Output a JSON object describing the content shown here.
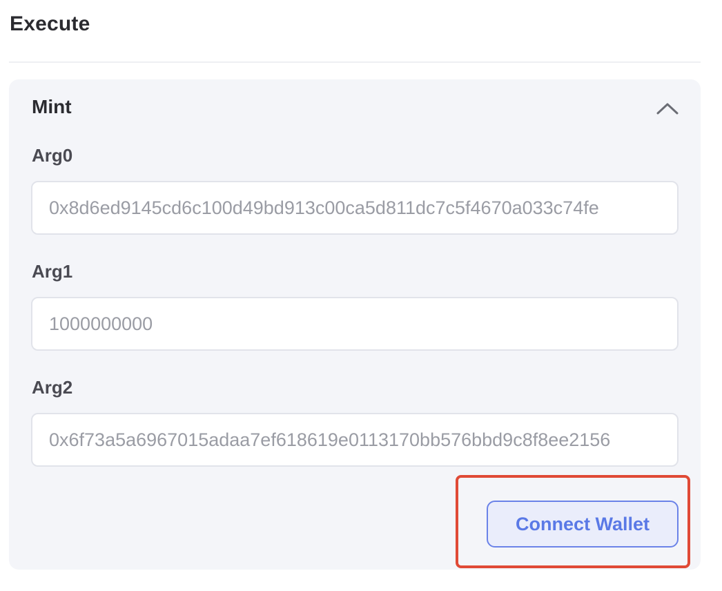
{
  "section": {
    "title": "Execute"
  },
  "card": {
    "title": "Mint",
    "collapse_icon": "chevron-up-icon",
    "args": [
      {
        "label": "Arg0",
        "placeholder": "0x8d6ed9145cd6c100d49bd913c00ca5d811dc7c5f4670a033c74fe"
      },
      {
        "label": "Arg1",
        "placeholder": "1000000000"
      },
      {
        "label": "Arg2",
        "placeholder": "0x6f73a5a6967015adaa7ef618619e0113170bb576bbd9c8f8ee2156"
      }
    ],
    "connect_label": "Connect Wallet"
  },
  "colors": {
    "accent": "#5a79e6",
    "highlight": "#e04a36",
    "card_bg": "#f4f5f9"
  }
}
